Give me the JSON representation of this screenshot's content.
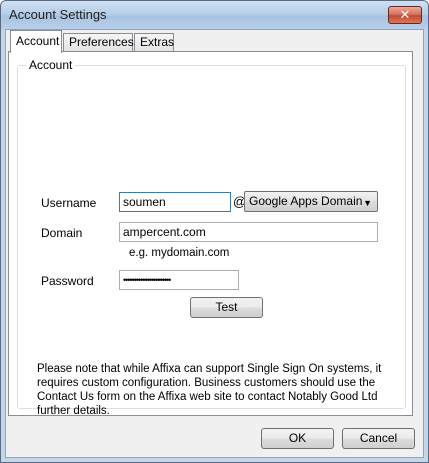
{
  "window": {
    "title": "Account Settings",
    "close_glyph": "✕"
  },
  "tabs": [
    {
      "label": "Account",
      "active": true
    },
    {
      "label": "Preferences",
      "active": false
    },
    {
      "label": "Extras",
      "active": false
    }
  ],
  "account_group": {
    "legend": "Account",
    "username_label": "Username",
    "username_value": "soumen",
    "at_sign": "@",
    "domain_type": "Google Apps Domain",
    "domain_label": "Domain",
    "domain_value": "ampercent.com",
    "domain_hint": "e.g. mydomain.com",
    "password_label": "Password",
    "password_value": "••••••••••••••••••••••",
    "test_button": "Test",
    "note": "Please note that while Affixa can support Single Sign On systems, it requires custom configuration. Business customers should use the Contact Us form on the Affixa web site to contact Notably Good Ltd further details."
  },
  "footer": {
    "ok_label": "OK",
    "cancel_label": "Cancel"
  }
}
